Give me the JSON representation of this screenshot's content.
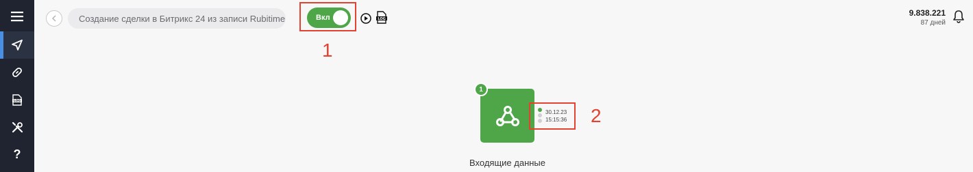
{
  "sidebar": {
    "items": [
      {
        "icon": "menu-icon"
      },
      {
        "icon": "send-icon",
        "active": true
      },
      {
        "icon": "link-icon"
      },
      {
        "icon": "log-icon"
      },
      {
        "icon": "tools-icon"
      },
      {
        "icon": "help-icon",
        "label": "?"
      }
    ]
  },
  "header": {
    "title": "Создание сделки в Битрикс 24 из записи Rubitime",
    "toggle_label": "Вкл",
    "toggle_on": true
  },
  "balance": {
    "value": "9.838.221",
    "days": "87 дней"
  },
  "markers": [
    "1",
    "2"
  ],
  "node": {
    "badge": "1",
    "icon": "webhook-icon",
    "label": "Входящие данные",
    "stats": {
      "date": "30.12.23",
      "time": "15:15:36"
    }
  },
  "colors": {
    "sidebar": "#1f2430",
    "accent_green": "#4ea649",
    "highlight_red": "#e2422f",
    "active_bar": "#4a90e2"
  }
}
